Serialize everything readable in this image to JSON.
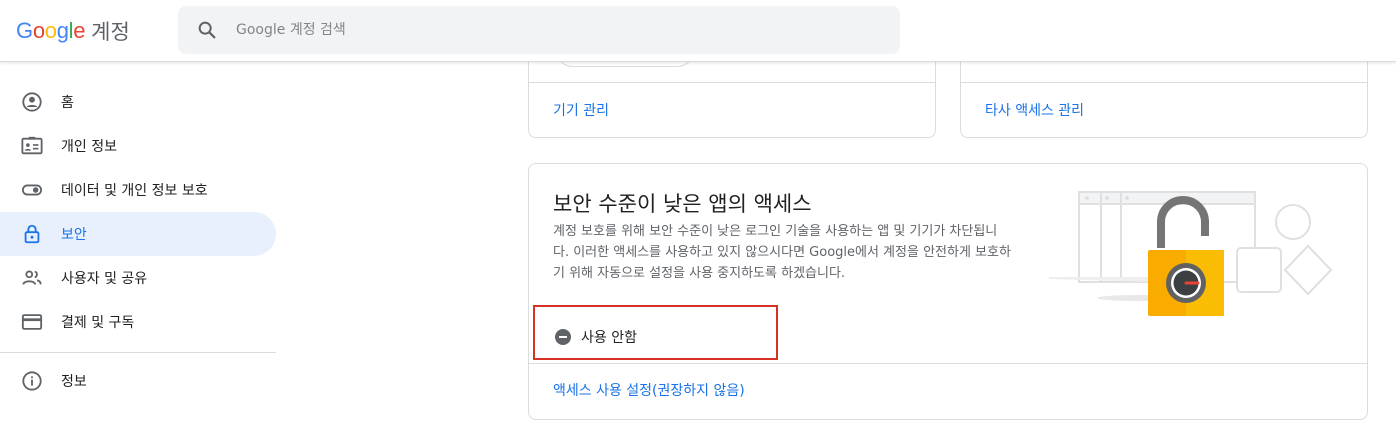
{
  "header": {
    "brand_google": "Google",
    "brand_account": "계정",
    "search_placeholder": "Google 계정 검색"
  },
  "sidebar": {
    "items": [
      {
        "label": "홈",
        "icon": "account-circle-icon"
      },
      {
        "label": "개인 정보",
        "icon": "id-card-icon"
      },
      {
        "label": "데이터 및 개인 정보 보호",
        "icon": "toggle-icon"
      },
      {
        "label": "보안",
        "icon": "lock-icon",
        "active": true
      },
      {
        "label": "사용자 및 공유",
        "icon": "people-icon"
      },
      {
        "label": "결제 및 구독",
        "icon": "credit-card-icon"
      },
      {
        "label": "정보",
        "icon": "info-icon"
      }
    ]
  },
  "cards": {
    "device_manage_link": "기기 관리",
    "third_party_link": "타사 액세스 관리"
  },
  "less_secure": {
    "title": "보안 수준이 낮은 앱의 액세스",
    "description": "계정 보호를 위해 보안 수준이 낮은 로그인 기술을 사용하는 앱 및 기기가 차단됩니다. 이러한 액세스를 사용하고 있지 않으시다면 Google에서 계정을 안전하게 보호하기 위해 자동으로 설정을 사용 중지하도록 하겠습니다.",
    "status": "사용 안함",
    "enable_link": "액세스 사용 설정(권장하지 않음)"
  },
  "colors": {
    "accent": "#1a73e8",
    "highlight_border": "#d93025",
    "active_bg": "#e8f0fe"
  }
}
